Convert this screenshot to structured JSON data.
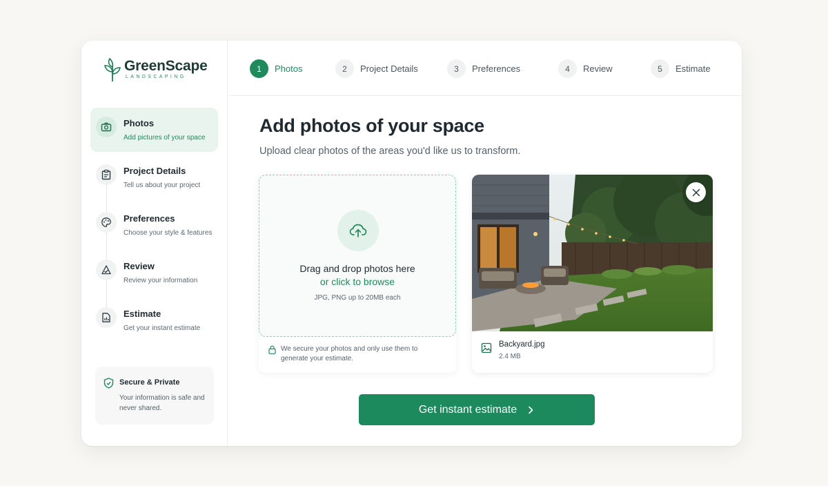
{
  "brand": {
    "name": "GreenScape",
    "tagline": "LANDSCAPING"
  },
  "colors": {
    "accent": "#1c8a5c",
    "accent_light": "#eaf4ef"
  },
  "stepper": [
    {
      "num": "1",
      "label": "Photos",
      "active": true
    },
    {
      "num": "2",
      "label": "Project Details",
      "active": false
    },
    {
      "num": "3",
      "label": "Preferences",
      "active": false
    },
    {
      "num": "4",
      "label": "Review",
      "active": false
    },
    {
      "num": "5",
      "label": "Estimate",
      "active": false
    }
  ],
  "sidebar": {
    "items": [
      {
        "title": "Photos",
        "subtitle": "Add pictures of your space",
        "icon": "camera-icon",
        "active": true
      },
      {
        "title": "Project Details",
        "subtitle": "Tell us about your project",
        "icon": "clipboard-icon",
        "active": false
      },
      {
        "title": "Preferences",
        "subtitle": "Choose your style & features",
        "icon": "palette-icon",
        "active": false
      },
      {
        "title": "Review",
        "subtitle": "Review your information",
        "icon": "review-icon",
        "active": false
      },
      {
        "title": "Estimate",
        "subtitle": "Get your instant estimate",
        "icon": "document-icon",
        "active": false
      }
    ],
    "secure": {
      "title": "Secure & Private",
      "text": "Your information is safe and never shared."
    }
  },
  "main": {
    "title": "Add photos of your space",
    "subtitle": "Upload clear photos of the areas you'd like us to transform.",
    "dropzone": {
      "title": "Drag and drop photos here",
      "link": "or click to browse",
      "hint": "JPG, PNG up to 20MB each"
    },
    "privacy_note": "We secure your photos and only use them to generate your estimate.",
    "uploaded": {
      "file_name": "Backyard.jpg",
      "file_size": "2.4 MB"
    },
    "cta_label": "Get instant estimate"
  }
}
